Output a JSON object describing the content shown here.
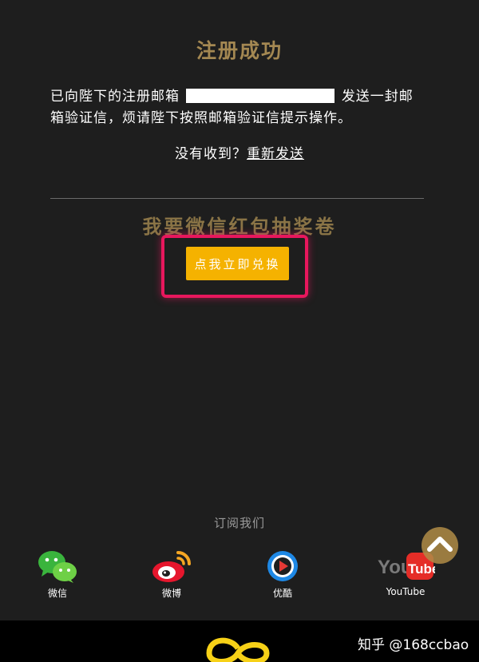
{
  "page": {
    "title": "注册成功",
    "message_line1_prefix": "已向陛下的注册邮箱",
    "message_line1_suffix": "发送一封邮",
    "message_line2": "箱验证信，烦请陛下按照邮箱验证信提示操作。",
    "resend_prompt": "没有收到？",
    "resend_link": "重新发送"
  },
  "promo": {
    "title": "我要微信红包抽奖卷",
    "button_label": "点我立即兑换",
    "highlight_color": "#e8175d",
    "button_color": "#f5b200"
  },
  "footer": {
    "subscribe_label": "订阅我们",
    "socials": [
      {
        "label": "微信",
        "icon": "wechat-icon"
      },
      {
        "label": "微博",
        "icon": "weibo-icon"
      },
      {
        "label": "优酷",
        "icon": "youku-icon"
      },
      {
        "label": "YouTube",
        "icon": "youtube-icon"
      }
    ],
    "watermark": "知乎 @168ccbao"
  },
  "colors": {
    "background": "#1e1e1e",
    "title_gold": "#a48852",
    "footer_bar": "#000000"
  }
}
